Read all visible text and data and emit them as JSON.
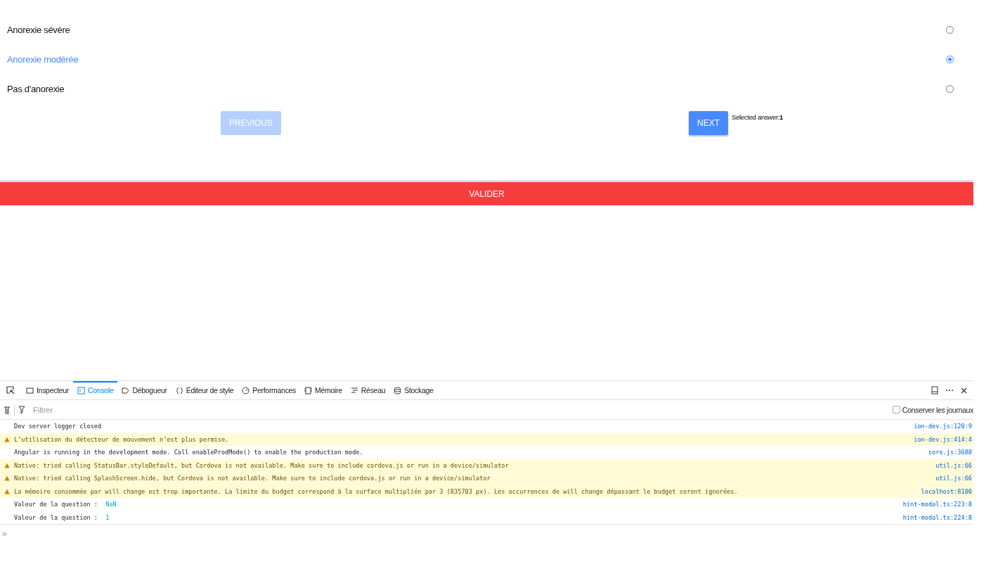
{
  "options": [
    {
      "label": "Anorexie sévère",
      "selected": false
    },
    {
      "label": "Anorexie modérée",
      "selected": true
    },
    {
      "label": "Pas d'anorexie",
      "selected": false
    }
  ],
  "previous_button": {
    "label": "PREVIOUS",
    "disabled": true
  },
  "next_button": {
    "label": "NEXT",
    "disabled": false
  },
  "selected_answer": {
    "label": "Selected answer:",
    "value": "1"
  },
  "validate_button": {
    "label": "VALIDER"
  },
  "devtools": {
    "tabs": [
      {
        "label": "Inspecteur",
        "selected": false
      },
      {
        "label": "Console",
        "selected": true
      },
      {
        "label": "Débogueur",
        "selected": false
      },
      {
        "label": "Éditeur de style",
        "selected": false
      },
      {
        "label": "Performances",
        "selected": false
      },
      {
        "label": "Mémoire",
        "selected": false
      },
      {
        "label": "Réseau",
        "selected": false
      },
      {
        "label": "Stockage",
        "selected": false
      }
    ],
    "filter": {
      "placeholder": "Filtrer"
    },
    "persist_logs": {
      "label": "Conserver les journaux",
      "checked": false
    },
    "messages": [
      {
        "kind": "log",
        "text": "Dev server logger closed",
        "source": "ion-dev.js:120:9"
      },
      {
        "kind": "warn",
        "text": "L’utilisation du détecteur de mouvement n’est plus permise.",
        "source": "ion-dev.js:414:4"
      },
      {
        "kind": "log",
        "text": "Angular is running in the development mode. Call enableProdMode() to enable the production mode.",
        "source": "core.js:3688"
      },
      {
        "kind": "warn",
        "text": "Native: tried calling StatusBar.styleDefault, but Cordova is not available. Make sure to include cordova.js or run in a device/simulator",
        "source": "util.js:66"
      },
      {
        "kind": "warn",
        "text": "Native: tried calling SplashScreen.hide, but Cordova is not available. Make sure to include cordova.js or run in a device/simulator",
        "source": "util.js:66"
      },
      {
        "kind": "warn",
        "text": "La mémoire consommée par will change est trop importante. La limite du budget correspond à la surface multipliée par 3 (835703 px). Les occurrences de will change dépassant le budget seront ignorées.",
        "source": "localhost:8100"
      },
      {
        "kind": "log",
        "text": "Valeur de la question : ",
        "value": "NaN",
        "source": "hint-modal.ts:223:8"
      },
      {
        "kind": "log",
        "text": "Valeur de la question : ",
        "value": "1",
        "source": "hint-modal.ts:224:8"
      }
    ],
    "prompt": "»"
  }
}
